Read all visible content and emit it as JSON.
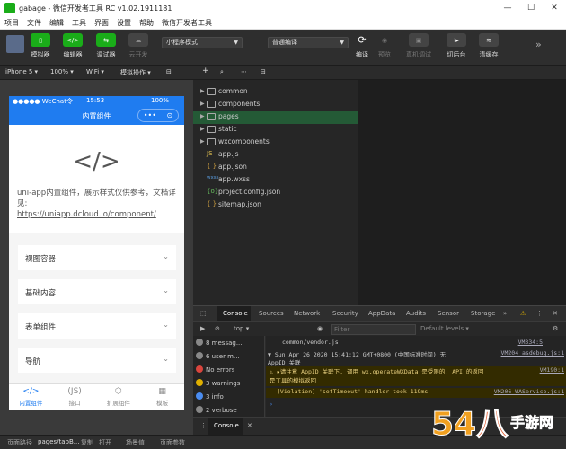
{
  "titlebar": {
    "title": "gabage - 微信开发者工具 RC v1.02.1911181",
    "min": "—",
    "max": "☐",
    "close": "✕"
  },
  "menu": [
    "项目",
    "文件",
    "编辑",
    "工具",
    "界面",
    "设置",
    "帮助",
    "微信开发者工具"
  ],
  "toolbar": {
    "simulator": "模拟器",
    "editor": "编辑器",
    "debugger": "调试器",
    "cloud": "云开发",
    "mode": "小程序模式",
    "compile": "普通编译",
    "compile_label": "编译",
    "preview": "预览",
    "realdebug": "真机调试",
    "background": "切后台",
    "cache": "清缓存"
  },
  "bar2": {
    "device": "iPhone 5",
    "zoom": "100%",
    "network": "WiFi",
    "simop": "模拟操作"
  },
  "phone": {
    "carrier": "●●●●● WeChat令",
    "time": "15:53",
    "battery": "100%",
    "nav_title": "内置组件",
    "capsule_dots": "•••",
    "capsule_close": "⊙",
    "code_glyph": "</>",
    "desc": "uni-app内置组件，展示样式仅供参考，文档详见:",
    "link": "https://uniapp.dcloud.io/component/",
    "items": [
      "视图容器",
      "基础内容",
      "表单组件",
      "导航"
    ],
    "tabs": [
      {
        "icon": "</>",
        "label": "内置组件"
      },
      {
        "icon": "(JS)",
        "label": "接口"
      },
      {
        "icon": "⬡",
        "label": "扩展组件"
      },
      {
        "icon": "▦",
        "label": "模板"
      }
    ]
  },
  "tree": [
    {
      "type": "folder",
      "name": "common"
    },
    {
      "type": "folder",
      "name": "components"
    },
    {
      "type": "folder",
      "name": "pages"
    },
    {
      "type": "folder",
      "name": "static"
    },
    {
      "type": "folder",
      "name": "wxcomponents"
    },
    {
      "type": "file",
      "icon": "JS",
      "name": "app.js"
    },
    {
      "type": "file",
      "icon": "{ }",
      "name": "app.json"
    },
    {
      "type": "file",
      "icon": "wxss",
      "name": "app.wxss"
    },
    {
      "type": "file",
      "icon": "{o}",
      "name": "project.config.json"
    },
    {
      "type": "file",
      "icon": "{ }",
      "name": "sitemap.json"
    }
  ],
  "devtools": {
    "tabs": [
      "Console",
      "Sources",
      "Network",
      "Security",
      "AppData",
      "Audits",
      "Sensor",
      "Storage"
    ],
    "more": "»",
    "context": "top",
    "filter_placeholder": "Filter",
    "levels": "Default levels ▾",
    "side": [
      {
        "label": "8 messag...",
        "color": "#888"
      },
      {
        "label": "6 user m...",
        "color": "#888"
      },
      {
        "label": "No errors",
        "color": "#d9453d"
      },
      {
        "label": "3 warnings",
        "color": "#e0b000"
      },
      {
        "label": "3 info",
        "color": "#4a8cf0"
      },
      {
        "label": "2 verbose",
        "color": "#888"
      }
    ],
    "logs": [
      {
        "text": "common/vendor.js",
        "src": "VM334:5"
      },
      {
        "text": "▼ Sun Apr 26 2020 15:41:12 GMT+0800 (中国标准时间) 无",
        "src": "VM204 asdebug.js:1"
      },
      {
        "text": "  AppID 关联",
        "src": ""
      },
      {
        "text": "⚠ ▸请注意 AppID 关联下, 调用 wx.operateWXData 是受限的, API 的返回",
        "src": "VM190:1"
      },
      {
        "text": "    是工具的模拟返回",
        "src": ""
      },
      {
        "text": "[Violation] 'setTimeout' handler took 119ms",
        "src": "VM206 WAService.js:1"
      },
      {
        "text": "›",
        "src": ""
      }
    ],
    "footer_tab": "Console"
  },
  "statusbar": {
    "path_label": "页面路径",
    "path": "pages/tabB...",
    "copy": "复制",
    "open": "打开",
    "scene": "场景值",
    "params": "页面参数"
  },
  "watermark": "54八手游网"
}
